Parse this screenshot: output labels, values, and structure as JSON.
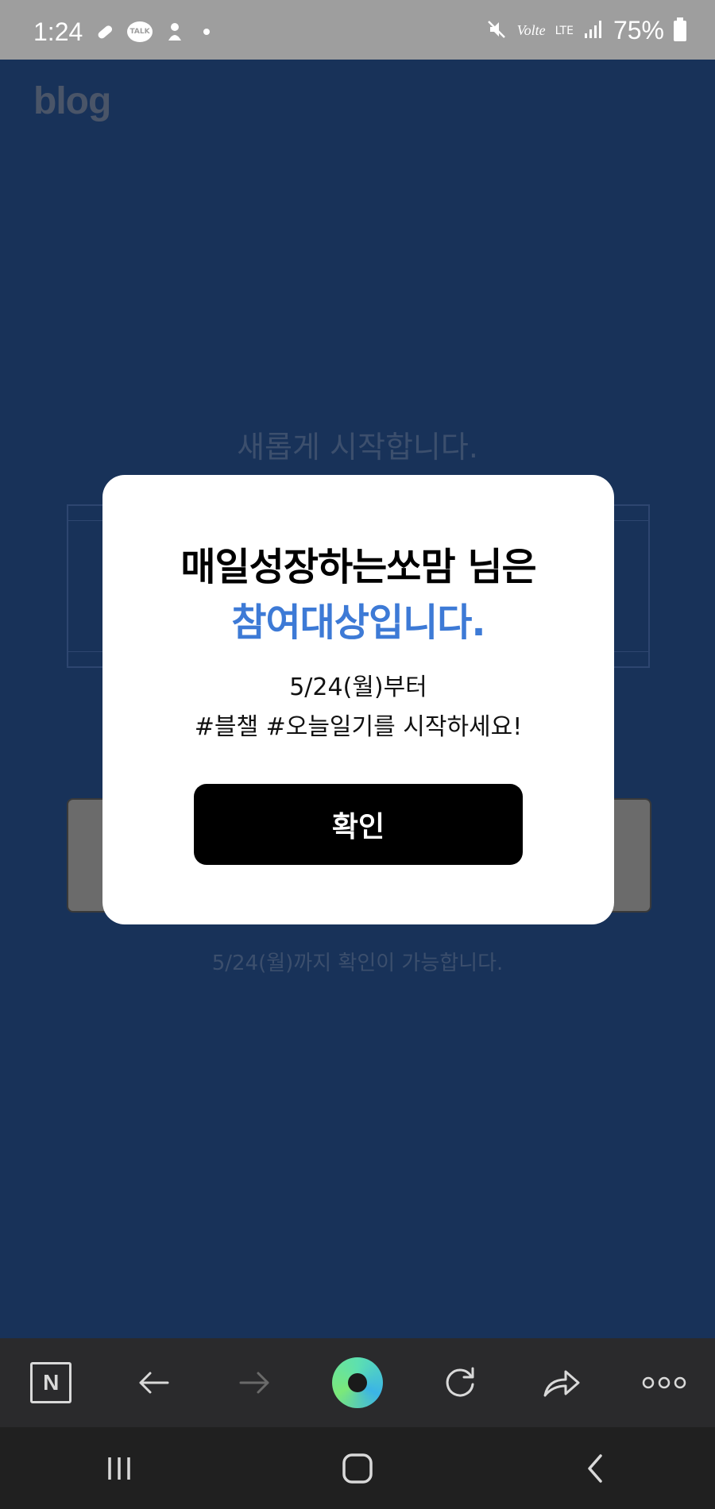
{
  "status_bar": {
    "time": "1:24",
    "talk_label": "TALK",
    "volte": "Volte",
    "lte": "LTE",
    "battery": "75%"
  },
  "page": {
    "logo": "blog",
    "headline": "새롭게 시작합니다.",
    "footnote": "5/24(월)까지 확인이 가능합니다."
  },
  "modal": {
    "title_line1": "매일성장하는쏘맘 님은",
    "title_line2": "참여대상입니다.",
    "subtitle_line1": "5/24(월)부터",
    "subtitle_line2": "#블챌 #오늘일기를 시작하세요!",
    "confirm_label": "확인"
  },
  "toolbar": {
    "naver_label": "N",
    "icons": [
      "naver-n-icon",
      "back-arrow-icon",
      "forward-arrow-icon",
      "green-ring-icon",
      "refresh-icon",
      "share-icon",
      "more-icon"
    ]
  },
  "colors": {
    "page_bg": "#183259",
    "accent_blue": "#3d7ad6",
    "button_bg": "#000000",
    "toolbar_bg": "#2a2a2c"
  }
}
